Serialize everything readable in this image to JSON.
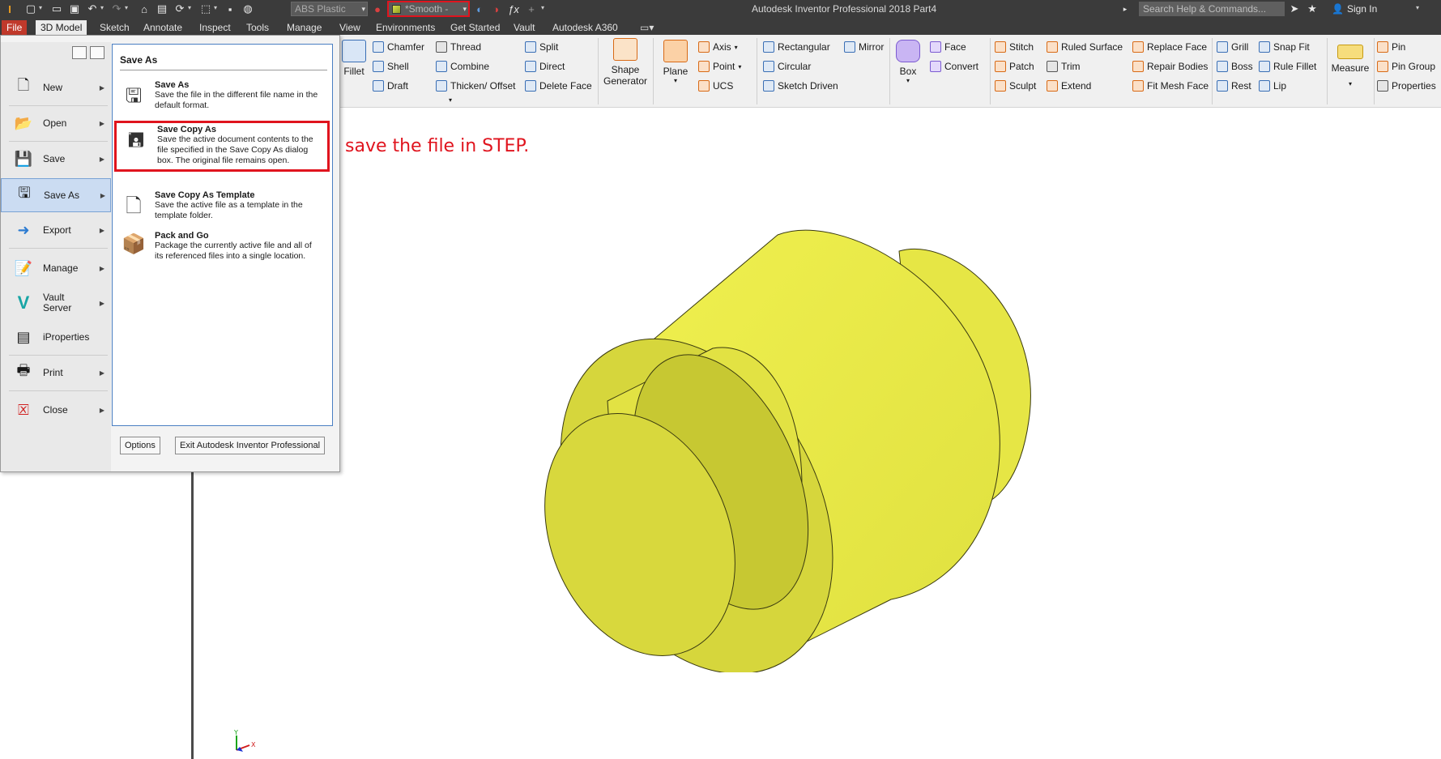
{
  "titlebar": {
    "material": "ABS Plastic",
    "appearance": "*Smooth -",
    "window_title": "Autodesk Inventor Professional 2018   Part4",
    "search_placeholder": "Search Help & Commands...",
    "sign_in": "Sign In"
  },
  "tabs": [
    {
      "label": "File"
    },
    {
      "label": "3D Model"
    },
    {
      "label": "Sketch"
    },
    {
      "label": "Annotate"
    },
    {
      "label": "Inspect"
    },
    {
      "label": "Tools"
    },
    {
      "label": "Manage"
    },
    {
      "label": "View"
    },
    {
      "label": "Environments"
    },
    {
      "label": "Get Started"
    },
    {
      "label": "Vault"
    },
    {
      "label": "Autodesk A360"
    }
  ],
  "ribbon": {
    "fillet": "Fillet",
    "chamfer": "Chamfer",
    "shell": "Shell",
    "draft": "Draft",
    "thread": "Thread",
    "combine": "Combine",
    "thicken": "Thicken/ Offset",
    "split": "Split",
    "direct": "Direct",
    "delete_face": "Delete Face",
    "shape_generator": "Shape Generator",
    "plane": "Plane",
    "axis": "Axis",
    "point": "Point",
    "ucs": "UCS",
    "rectangular": "Rectangular",
    "circular": "Circular",
    "sketch_driven": "Sketch Driven",
    "mirror": "Mirror",
    "box": "Box",
    "face": "Face",
    "convert": "Convert",
    "stitch": "Stitch",
    "patch": "Patch",
    "sculpt": "Sculpt",
    "ruled_surface": "Ruled Surface",
    "trim": "Trim",
    "extend": "Extend",
    "replace_face": "Replace Face",
    "repair_bodies": "Repair Bodies",
    "fit_mesh_face": "Fit Mesh Face",
    "grill": "Grill",
    "boss": "Boss",
    "rest": "Rest",
    "snap_fit": "Snap Fit",
    "rule_fillet": "Rule Fillet",
    "lip": "Lip",
    "measure": "Measure",
    "pin": "Pin",
    "pin_group": "Pin Group",
    "properties": "Properties"
  },
  "file_menu": {
    "items": [
      {
        "label": "New"
      },
      {
        "label": "Open"
      },
      {
        "label": "Save"
      },
      {
        "label": "Save As"
      },
      {
        "label": "Export"
      },
      {
        "label": "Manage"
      },
      {
        "label": "Vault Server"
      },
      {
        "label": "iProperties"
      },
      {
        "label": "Print"
      },
      {
        "label": "Close"
      }
    ],
    "panel_title": "Save As",
    "sub_items": [
      {
        "title": "Save As",
        "desc": "Save the file in the different file name in the default format."
      },
      {
        "title": "Save Copy As",
        "desc": "Save the active document contents to the file specified in the Save Copy As dialog box. The original file remains open."
      },
      {
        "title": "Save Copy As Template",
        "desc": "Save the active file as a template in the template folder."
      },
      {
        "title": "Pack and Go",
        "desc": "Package the currently active file and all of its referenced files into a single location."
      }
    ],
    "options_label": "Options",
    "exit_label": "Exit Autodesk Inventor Professional"
  },
  "annotation": "save the file in STEP.",
  "colors": {
    "highlight": "#e0141e",
    "part_yellow": "#e8e84a",
    "titlebar": "#3b3b3b",
    "active_menu": "#cbdcf2"
  },
  "triad": {
    "y": "Y",
    "x": "X"
  }
}
